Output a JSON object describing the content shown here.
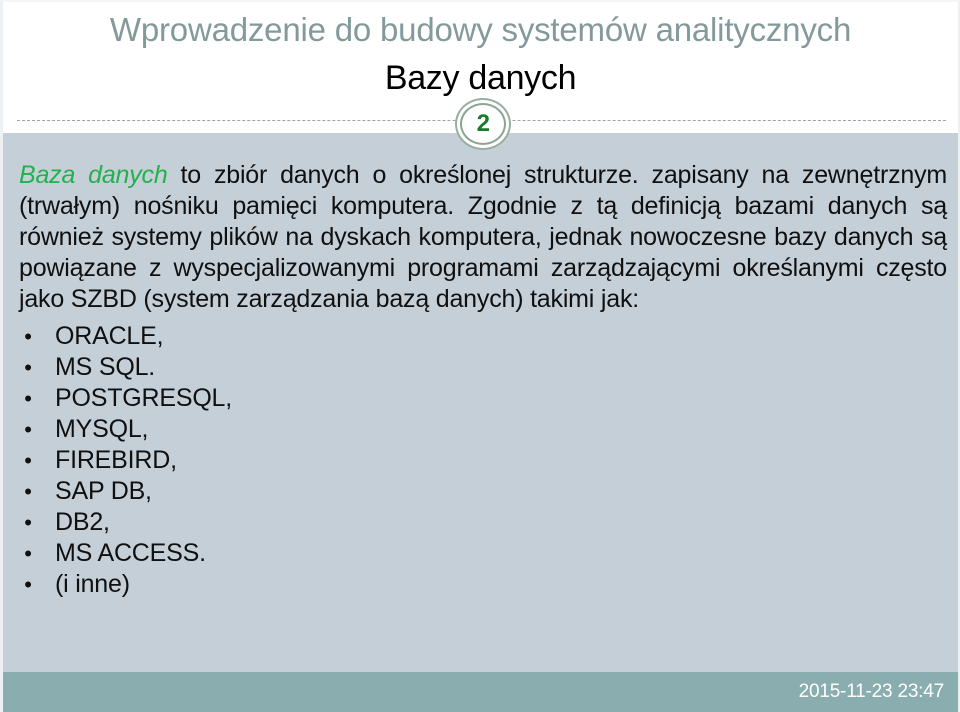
{
  "slide": {
    "deck_title": "Wprowadzenie do budowy systemów analitycznych",
    "slide_title": "Bazy danych",
    "page_number": "2",
    "colors": {
      "body_background": "#c5cfd7",
      "header_background": "#ffffff",
      "deck_title": "#83999a",
      "slide_title": "#000000",
      "term_green": "#22b24c",
      "badge_number_green": "#197a2e",
      "badge_ring": "#9aae9f",
      "footer_background": "#8aaeaf",
      "footer_text": "#ffffff",
      "body_text": "#101010",
      "dashed_rule": "#9aa4ad"
    }
  },
  "body": {
    "paragraph": {
      "term": "Baza danych",
      "rest": " to zbiór danych o określonej strukturze. zapisany na zewnętrznym (trwałym) nośniku pamięci komputera. Zgodnie z tą definicją bazami danych są również systemy plików na dyskach komputera, jednak nowoczesne bazy danych są powiązane z wyspecjalizowanymi programami zarządzającymi określanymi często jako SZBD (system zarządzania bazą danych) takimi jak:"
    },
    "bullet_marker": "•",
    "bullets": [
      "ORACLE,",
      "MS SQL.",
      "POSTGRESQL,",
      "MYSQL,",
      "FIREBIRD,",
      "SAP DB,",
      "DB2,",
      "MS ACCESS.",
      "(i inne)"
    ]
  },
  "footer": {
    "timestamp": "2015-11-23 23:47"
  }
}
